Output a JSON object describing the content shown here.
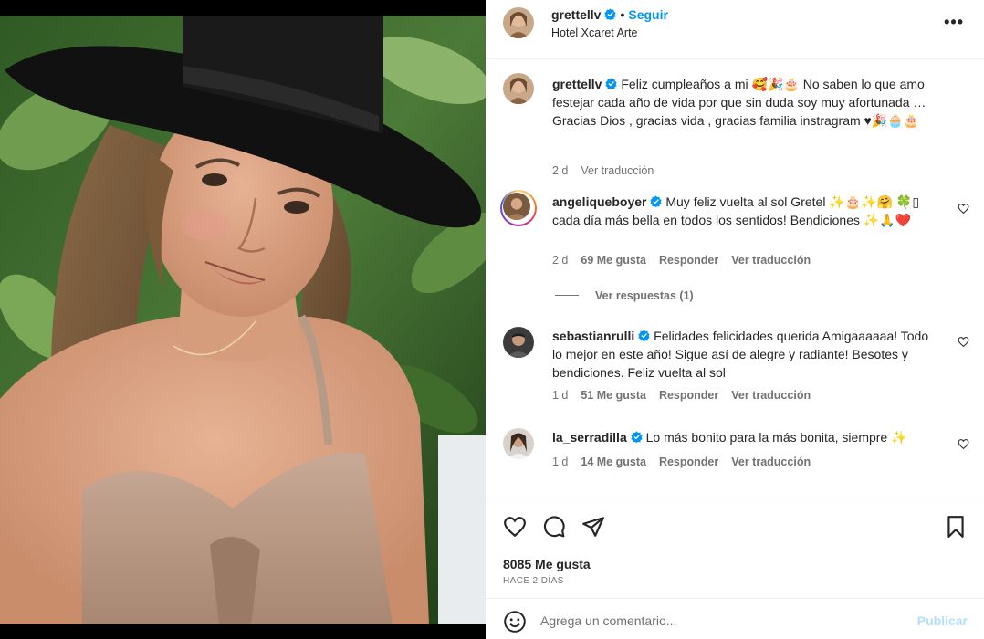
{
  "post": {
    "username": "grettellv",
    "follow_label": "Seguir",
    "separator": "•",
    "location": "Hotel Xcaret Arte",
    "more_label": "•••"
  },
  "caption": {
    "username": "grettellv",
    "text": "Feliz cumpleaños a mi 🥰🎉🎂 No saben lo que amo festejar cada año de vida por que sin duda soy muy afortunada … Gracias Dios , gracias vida , gracias familia instragram ♥🎉🧁🎂",
    "time": "2 d",
    "translate": "Ver traducción"
  },
  "comments": [
    {
      "username": "angeliqueboyer",
      "text": "Muy feliz vuelta al sol Gretel ✨🎂✨🤗 🍀▯ cada día más bella en todos los sentidos! Bendiciones ✨🙏❤️",
      "time": "2 d",
      "likes": "69 Me gusta",
      "reply": "Responder",
      "translate": "Ver traducción",
      "view_replies": "Ver respuestas (1)"
    },
    {
      "username": "sebastianrulli",
      "text": "Felidades felicidades querida Amigaaaaaa! Todo lo mejor en este año! Sigue así de alegre y radiante! Besotes y bendiciones. Feliz vuelta al sol",
      "time": "1 d",
      "likes": "51 Me gusta",
      "reply": "Responder",
      "translate": "Ver traducción"
    },
    {
      "username": "la_serradilla",
      "text": "Lo más bonito para la más bonita, siempre ✨",
      "time": "1 d",
      "likes": "14 Me gusta",
      "reply": "Responder",
      "translate": "Ver traducción"
    }
  ],
  "footer": {
    "likes": "8085 Me gusta",
    "date": "HACE 2 DÍAS",
    "comment_placeholder": "Agrega un comentario...",
    "publish": "Publicar"
  },
  "colors": {
    "accent": "#0095f6",
    "verified": "#0095f6",
    "muted": "#737373",
    "publish_disabled": "#b2dffc"
  },
  "icons": [
    "heart-icon",
    "comment-icon",
    "share-icon",
    "bookmark-icon",
    "emoji-icon",
    "verified-badge-icon",
    "more-options-icon"
  ]
}
